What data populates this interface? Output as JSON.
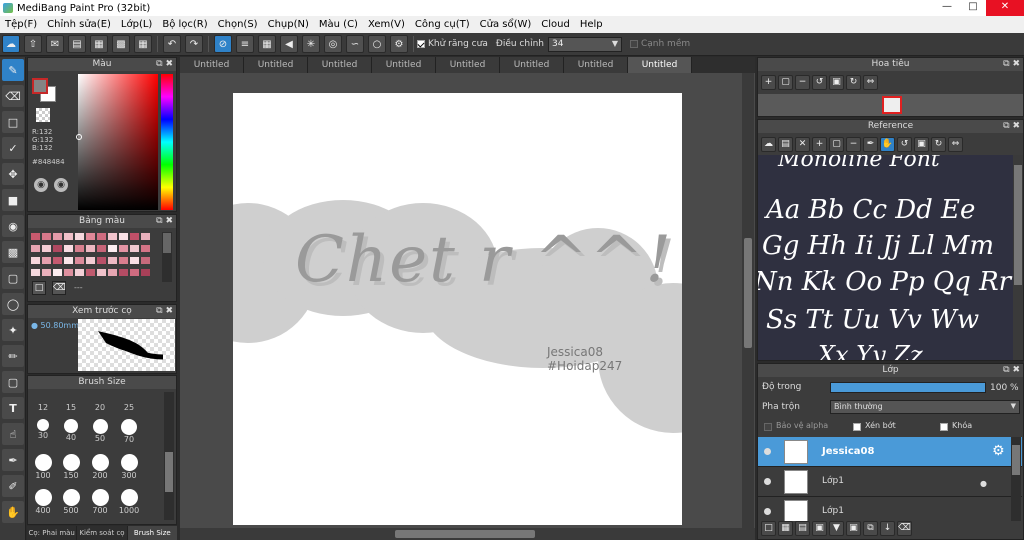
{
  "window": {
    "title": "MediBang Paint Pro (32bit)"
  },
  "menu": [
    "Tệp(F)",
    "Chỉnh sửa(E)",
    "Lớp(L)",
    "Bộ lọc(R)",
    "Chọn(S)",
    "Chụp(N)",
    "Màu (C)",
    "Xem(V)",
    "Công cụ(T)",
    "Cửa sổ(W)",
    "Cloud",
    "Help"
  ],
  "toolbar": {
    "antialias_label": "Khử răng cưa",
    "adjust_label": "Điều chỉnh",
    "adjust_value": "34",
    "sharp_edge_label": "Cạnh mềm"
  },
  "color_panel": {
    "title": "Màu",
    "r": "R:132",
    "g": "G:132",
    "b": "B:132",
    "hex": "#848484"
  },
  "swatch_panel": {
    "title": "Bảng màu",
    "footer_text": "---"
  },
  "brush_preview": {
    "title": "Xem trước cọ",
    "size": "50.80mm"
  },
  "brush_size": {
    "title": "Brush Size",
    "sizes": [
      "12",
      "15",
      "20",
      "25",
      "30",
      "40",
      "50",
      "70",
      "100",
      "150",
      "200",
      "300",
      "400",
      "500",
      "700",
      "1000"
    ]
  },
  "bottom_tabs": [
    "Cọ: Phai màu",
    "Kiểm soát cọ",
    "Brush Size"
  ],
  "doc_tabs": [
    "Untitled",
    "Untitled",
    "Untitled",
    "Untitled",
    "Untitled",
    "Untitled",
    "Untitled",
    "Untitled"
  ],
  "canvas": {
    "main_text": "Chet r ^^!",
    "watermark_line1": "Jessica08",
    "watermark_line2": "#Hoidap247"
  },
  "navigator": {
    "title": "Hoa tiêu"
  },
  "reference": {
    "title": "Reference",
    "lines": [
      "Monoline Font",
      "Aa Bb Cc Dd Ee",
      "Gg Hh Ii Jj Ll Mm",
      "Nn Kk Oo Pp Qq Rr",
      "Ss Tt Uu Vv Ww",
      "Xx Yy Zz"
    ]
  },
  "layer_panel": {
    "title": "Lớp",
    "opacity_label": "Độ trong",
    "opacity_value": "100 %",
    "opacity_fraction": 1.0,
    "blend_label": "Pha trộn",
    "blend_value": "Bình thường",
    "protect_alpha": "Bảo vệ alpha",
    "clipping": "Xén bớt",
    "lock": "Khóa",
    "layers": [
      {
        "name": "Jessica08",
        "selected": true
      },
      {
        "name": "Lớp1",
        "selected": false
      },
      {
        "name": "Lớp1",
        "selected": false
      }
    ]
  },
  "colors": {
    "accent": "#4a9ad8",
    "current_color": "#848484",
    "nav_highlight": "#e02020"
  }
}
